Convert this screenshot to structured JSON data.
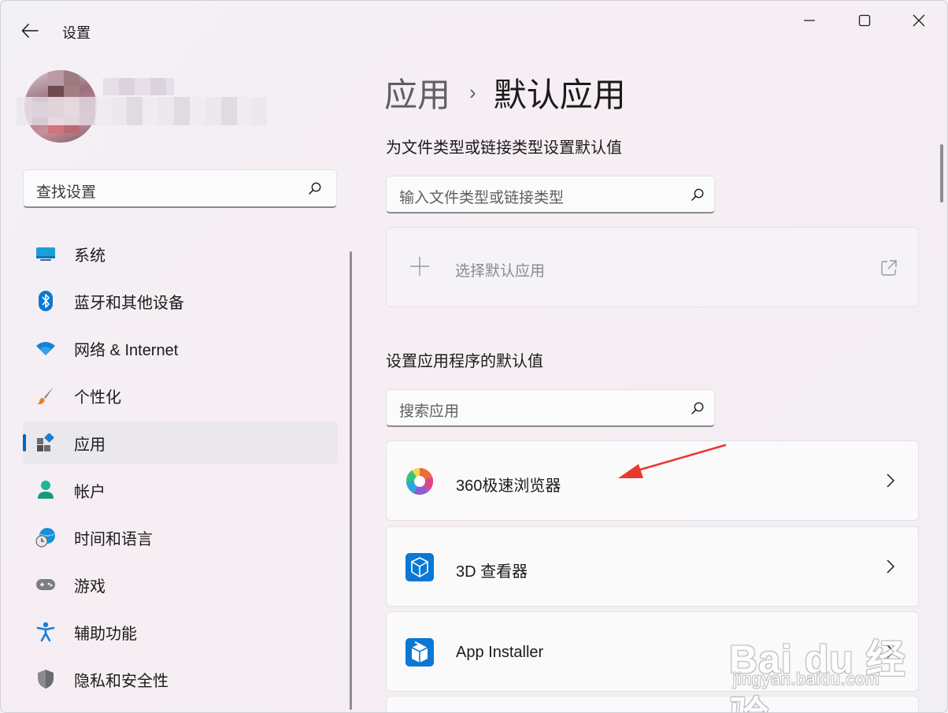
{
  "window": {
    "title": "设置",
    "controls": [
      "minimize",
      "maximize",
      "close"
    ]
  },
  "sidebar": {
    "search_placeholder": "查找设置",
    "items": [
      {
        "label": "系统",
        "icon": "monitor-icon",
        "active": false
      },
      {
        "label": "蓝牙和其他设备",
        "icon": "bluetooth-icon",
        "active": false
      },
      {
        "label": "网络 & Internet",
        "icon": "wifi-icon",
        "active": false
      },
      {
        "label": "个性化",
        "icon": "paintbrush-icon",
        "active": false
      },
      {
        "label": "应用",
        "icon": "apps-icon",
        "active": true
      },
      {
        "label": "帐户",
        "icon": "account-icon",
        "active": false
      },
      {
        "label": "时间和语言",
        "icon": "globe-clock-icon",
        "active": false
      },
      {
        "label": "游戏",
        "icon": "gamepad-icon",
        "active": false
      },
      {
        "label": "辅助功能",
        "icon": "accessibility-icon",
        "active": false
      },
      {
        "label": "隐私和安全性",
        "icon": "shield-icon",
        "active": false
      }
    ]
  },
  "breadcrumb": {
    "parent": "应用",
    "separator": "›",
    "current": "默认应用"
  },
  "file_types_section": {
    "title": "为文件类型或链接类型设置默认值",
    "search_placeholder": "输入文件类型或链接类型",
    "choose_default_label": "选择默认应用"
  },
  "apps_section": {
    "title": "设置应用程序的默认值",
    "search_placeholder": "搜索应用",
    "apps": [
      {
        "name": "360极速浏览器",
        "icon": "browser-360-icon"
      },
      {
        "name": "3D 查看器",
        "icon": "3d-viewer-icon"
      },
      {
        "name": "App Installer",
        "icon": "app-installer-icon"
      }
    ]
  },
  "watermark": {
    "logo": "Bai du 经验",
    "url": "jingyan.baidu.com"
  },
  "colors": {
    "accent": "#0067c0",
    "annotation_arrow": "#e8392f"
  }
}
